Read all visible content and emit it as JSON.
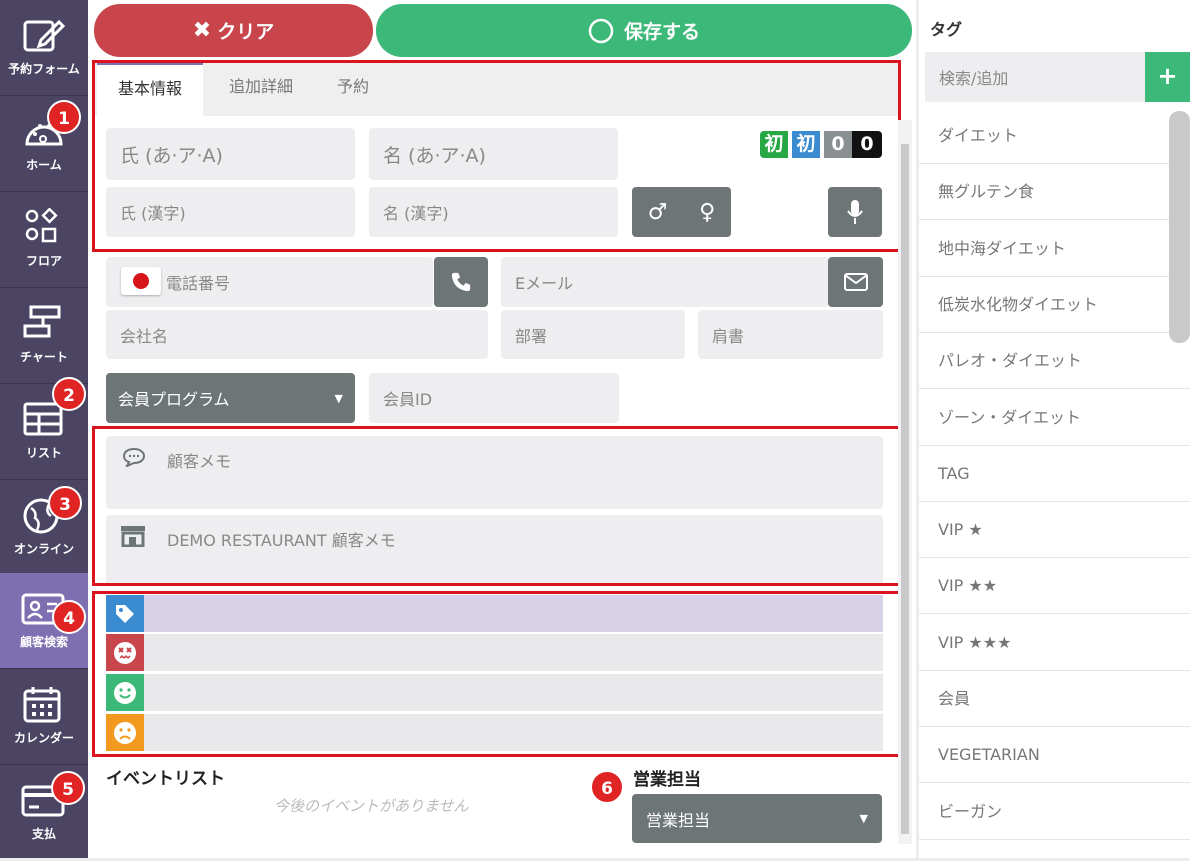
{
  "sidebar": {
    "items": [
      {
        "label": "予約フォーム",
        "icon": "edit-icon",
        "active": false
      },
      {
        "label": "ホーム",
        "icon": "palette-icon",
        "active": false,
        "badge": "1"
      },
      {
        "label": "フロア",
        "icon": "floor-icon",
        "active": false
      },
      {
        "label": "チャート",
        "icon": "chart-icon",
        "active": false
      },
      {
        "label": "リスト",
        "icon": "table-icon",
        "active": false,
        "badge": "2"
      },
      {
        "label": "オンライン",
        "icon": "globe-icon",
        "active": false,
        "badge": "3"
      },
      {
        "label": "顧客検索",
        "icon": "id-card-icon",
        "active": true,
        "badge": "4"
      },
      {
        "label": "カレンダー",
        "icon": "calendar-icon",
        "active": false
      },
      {
        "label": "支払",
        "icon": "credit-card-icon",
        "active": false,
        "badge": "5"
      }
    ]
  },
  "toolbar": {
    "clear_label": "クリア",
    "save_label": "保存する"
  },
  "tabs": [
    {
      "label": "基本情報",
      "active": true
    },
    {
      "label": "追加詳細",
      "active": false
    },
    {
      "label": "予約",
      "active": false
    }
  ],
  "form": {
    "last_kana_placeholder": "氏 (あ·ア·A)",
    "first_kana_placeholder": "名 (あ·ア·A)",
    "last_kanji_placeholder": "氏 (漢字)",
    "first_kanji_placeholder": "名 (漢字)",
    "phone_placeholder": "電話番号",
    "email_placeholder": "Eメール",
    "company_placeholder": "会社名",
    "department_placeholder": "部署",
    "title_placeholder": "肩書",
    "membership_select": "会員プログラム",
    "member_id_placeholder": "会員ID",
    "memo_placeholder": "顧客メモ",
    "restaurant_memo_placeholder": "DEMO RESTAURANT 顧客メモ"
  },
  "counters": [
    {
      "label": "初",
      "color": "#27a844"
    },
    {
      "label": "初",
      "color": "#3b8bd0"
    },
    {
      "label": "0",
      "color": "#8a8f91"
    },
    {
      "label": "0",
      "color": "#111111"
    }
  ],
  "strips": [
    {
      "icon": "tag-icon",
      "color": "#3b8bd0",
      "bg": "#d7d2e7"
    },
    {
      "icon": "dizzy-face-icon",
      "color": "#c8454c",
      "bg": "#e9e9eb"
    },
    {
      "icon": "smile-face-icon",
      "color": "#3cb878",
      "bg": "#e9e9eb"
    },
    {
      "icon": "sad-face-icon",
      "color": "#f29a1f",
      "bg": "#e9e9eb"
    }
  ],
  "events": {
    "title": "イベントリスト",
    "empty": "今後のイベントがありません"
  },
  "sales": {
    "title": "営業担当",
    "select": "営業担当",
    "badge": "6"
  },
  "tag_panel": {
    "title": "タグ",
    "search_placeholder": "検索/追加",
    "add_label": "+",
    "tags": [
      "ダイエット",
      "無グルテン食",
      "地中海ダイエット",
      "低炭水化物ダイエット",
      "パレオ・ダイエット",
      "ゾーン・ダイエット",
      "TAG",
      "VIP ★",
      "VIP ★★",
      "VIP ★★★",
      "会員",
      "VEGETARIAN",
      "ビーガン"
    ]
  }
}
